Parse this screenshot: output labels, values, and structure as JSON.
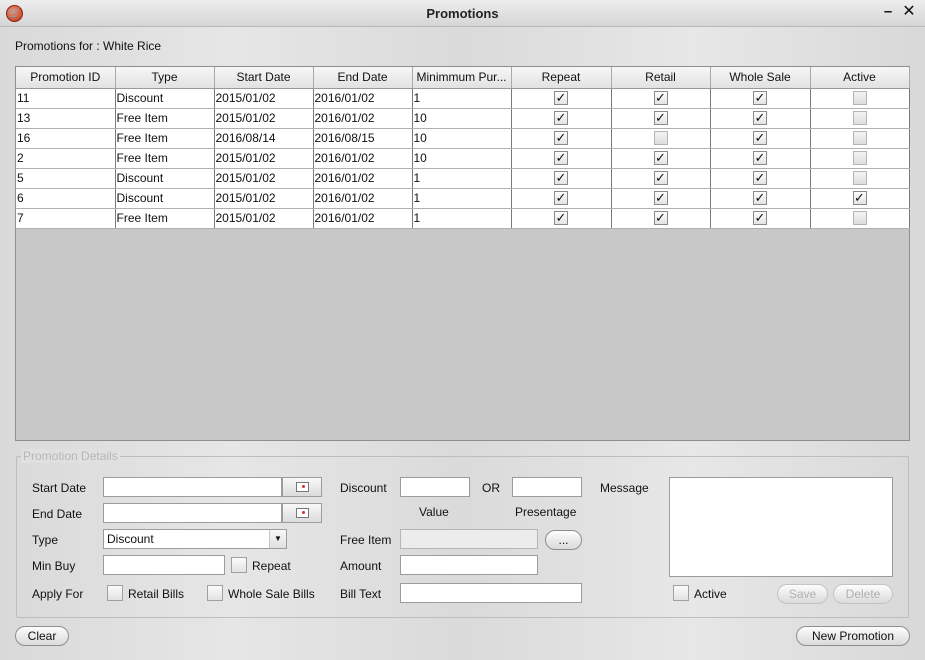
{
  "window": {
    "title": "Promotions",
    "min_symbol": "–",
    "close_symbol": "✕"
  },
  "header": {
    "subtitle": "Promotions for : White Rice"
  },
  "table": {
    "columns": [
      "Promotion ID",
      "Type",
      "Start Date",
      "End Date",
      "Minimmum Pur...",
      "Repeat",
      "Retail",
      "Whole Sale",
      "Active"
    ],
    "rows": [
      {
        "id": "11",
        "type": "Discount",
        "start": "2015/01/02",
        "end": "2016/01/02",
        "min": "1",
        "repeat": true,
        "retail": true,
        "wholesale": true,
        "active": false
      },
      {
        "id": "13",
        "type": "Free Item",
        "start": "2015/01/02",
        "end": "2016/01/02",
        "min": "10",
        "repeat": true,
        "retail": true,
        "wholesale": true,
        "active": false
      },
      {
        "id": "16",
        "type": "Free Item",
        "start": "2016/08/14",
        "end": "2016/08/15",
        "min": "10",
        "repeat": true,
        "retail": false,
        "wholesale": true,
        "active": false
      },
      {
        "id": "2",
        "type": "Free Item",
        "start": "2015/01/02",
        "end": "2016/01/02",
        "min": "10",
        "repeat": true,
        "retail": true,
        "wholesale": true,
        "active": false
      },
      {
        "id": "5",
        "type": "Discount",
        "start": "2015/01/02",
        "end": "2016/01/02",
        "min": "1",
        "repeat": true,
        "retail": true,
        "wholesale": true,
        "active": false
      },
      {
        "id": "6",
        "type": "Discount",
        "start": "2015/01/02",
        "end": "2016/01/02",
        "min": "1",
        "repeat": true,
        "retail": true,
        "wholesale": true,
        "active": true
      },
      {
        "id": "7",
        "type": "Free Item",
        "start": "2015/01/02",
        "end": "2016/01/02",
        "min": "1",
        "repeat": true,
        "retail": true,
        "wholesale": true,
        "active": false
      }
    ]
  },
  "details": {
    "group_title": "Promotion Details",
    "start_date_label": "Start Date",
    "end_date_label": "End  Date",
    "type_label": "Type",
    "type_value": "Discount",
    "min_buy_label": "Min Buy",
    "repeat_label": "Repeat",
    "apply_for_label": "Apply For",
    "retail_bills_label": "Retail Bills",
    "wholesale_bills_label": "Whole Sale Bills",
    "discount_label": "Discount",
    "or_label": "OR",
    "value_label": "Value",
    "percentage_label": "Presentage",
    "free_item_label": "Free Item",
    "browse_label": "...",
    "amount_label": "Amount",
    "bill_text_label": "Bill Text",
    "message_label": "Message",
    "active_label": "Active",
    "save_label": "Save",
    "delete_label": "Delete"
  },
  "footer": {
    "clear_label": "Clear",
    "new_promotion_label": "New Promotion"
  }
}
